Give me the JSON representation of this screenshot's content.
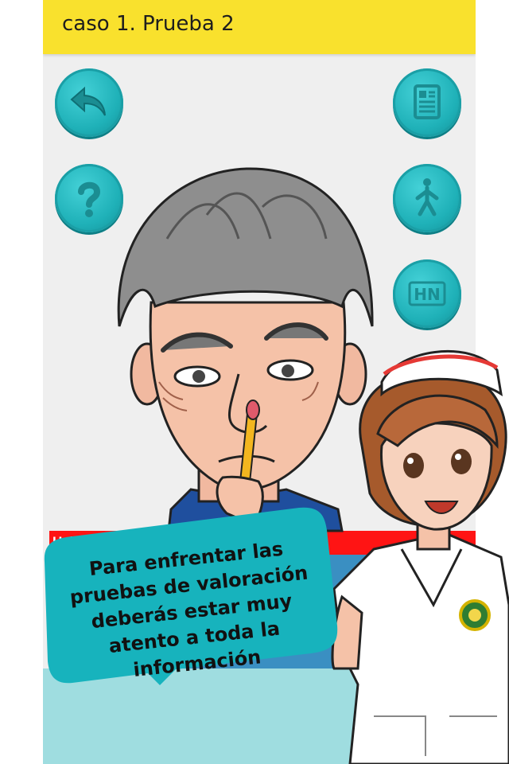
{
  "header": {
    "title": "caso 1. Prueba 2"
  },
  "buttons": {
    "back": {
      "icon": "back-arrow-icon"
    },
    "help": {
      "icon": "question-icon"
    },
    "record": {
      "icon": "document-icon"
    },
    "body": {
      "icon": "walking-person-icon"
    },
    "hn": {
      "icon": "hn-icon",
      "label": "HN"
    }
  },
  "finding_bar": {
    "label": "Hallaz"
  },
  "speech_bubble": {
    "lines": [
      "Para enfrentar las",
      "pruebas de valoración",
      "deberás estar muy",
      "atento a toda la",
      "información"
    ]
  },
  "colors": {
    "header": "#f9e12d",
    "button": "#1fb1b8",
    "bubble": "#17b3bd",
    "finding_bar": "#ff1414"
  }
}
